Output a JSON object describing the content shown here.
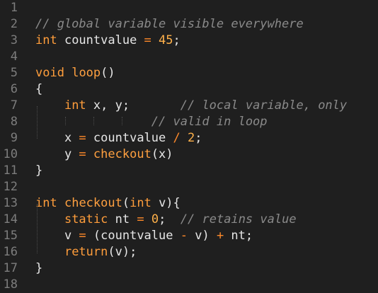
{
  "editor": {
    "background": "#1f1f1f",
    "colors": {
      "keyword": "#ff9d3b",
      "function": "#ffa040",
      "number": "#ffb14a",
      "operator": "#ff8a2a",
      "comment": "#8a8a8a",
      "text": "#e6e6e6",
      "line_number": "#7d7d7d"
    },
    "lines": [
      {
        "n": "1",
        "tokens": []
      },
      {
        "n": "2",
        "tokens": [
          {
            "t": "cm",
            "s": "// global variable visible everywhere"
          }
        ]
      },
      {
        "n": "3",
        "tokens": [
          {
            "t": "kw",
            "s": "int"
          },
          {
            "t": "tx",
            "s": " countvalue "
          },
          {
            "t": "op",
            "s": "="
          },
          {
            "t": "tx",
            "s": " "
          },
          {
            "t": "num",
            "s": "45"
          },
          {
            "t": "pn",
            "s": ";"
          }
        ]
      },
      {
        "n": "4",
        "tokens": []
      },
      {
        "n": "5",
        "tokens": [
          {
            "t": "kw",
            "s": "void"
          },
          {
            "t": "tx",
            "s": " "
          },
          {
            "t": "fn",
            "s": "loop"
          },
          {
            "t": "pn",
            "s": "()"
          }
        ]
      },
      {
        "n": "6",
        "tokens": [
          {
            "t": "pn",
            "s": "{"
          }
        ]
      },
      {
        "n": "7",
        "tokens": [
          {
            "t": "tx",
            "s": "    "
          },
          {
            "t": "kw",
            "s": "int"
          },
          {
            "t": "tx",
            "s": " x, y;       "
          },
          {
            "t": "cm",
            "s": "// local variable, only"
          }
        ]
      },
      {
        "n": "8",
        "tokens": [
          {
            "t": "tx",
            "s": "                "
          },
          {
            "t": "cm",
            "s": "// valid in loop"
          }
        ]
      },
      {
        "n": "9",
        "tokens": [
          {
            "t": "tx",
            "s": "    x "
          },
          {
            "t": "op",
            "s": "="
          },
          {
            "t": "tx",
            "s": " countvalue "
          },
          {
            "t": "op",
            "s": "/"
          },
          {
            "t": "tx",
            "s": " "
          },
          {
            "t": "num",
            "s": "2"
          },
          {
            "t": "pn",
            "s": ";"
          }
        ]
      },
      {
        "n": "10",
        "tokens": [
          {
            "t": "tx",
            "s": "    y "
          },
          {
            "t": "op",
            "s": "="
          },
          {
            "t": "tx",
            "s": " "
          },
          {
            "t": "fn",
            "s": "checkout"
          },
          {
            "t": "pn",
            "s": "(x)"
          }
        ]
      },
      {
        "n": "11",
        "tokens": [
          {
            "t": "pn",
            "s": "}"
          }
        ]
      },
      {
        "n": "12",
        "tokens": []
      },
      {
        "n": "13",
        "tokens": [
          {
            "t": "kw",
            "s": "int"
          },
          {
            "t": "tx",
            "s": " "
          },
          {
            "t": "fn",
            "s": "checkout"
          },
          {
            "t": "pn",
            "s": "("
          },
          {
            "t": "kw",
            "s": "int"
          },
          {
            "t": "tx",
            "s": " v){"
          }
        ]
      },
      {
        "n": "14",
        "tokens": [
          {
            "t": "tx",
            "s": "    "
          },
          {
            "t": "kw",
            "s": "static"
          },
          {
            "t": "tx",
            "s": " nt "
          },
          {
            "t": "op",
            "s": "="
          },
          {
            "t": "tx",
            "s": " "
          },
          {
            "t": "num",
            "s": "0"
          },
          {
            "t": "pn",
            "s": ";"
          },
          {
            "t": "tx",
            "s": "  "
          },
          {
            "t": "cm",
            "s": "// retains value"
          }
        ]
      },
      {
        "n": "15",
        "tokens": [
          {
            "t": "tx",
            "s": "    v "
          },
          {
            "t": "op",
            "s": "="
          },
          {
            "t": "tx",
            "s": " (countvalue "
          },
          {
            "t": "op",
            "s": "-"
          },
          {
            "t": "tx",
            "s": " v) "
          },
          {
            "t": "op",
            "s": "+"
          },
          {
            "t": "tx",
            "s": " nt;"
          }
        ]
      },
      {
        "n": "16",
        "tokens": [
          {
            "t": "tx",
            "s": "    "
          },
          {
            "t": "kw",
            "s": "return"
          },
          {
            "t": "pn",
            "s": "(v);"
          }
        ]
      },
      {
        "n": "17",
        "tokens": [
          {
            "t": "pn",
            "s": "}"
          }
        ]
      },
      {
        "n": "18",
        "tokens": []
      }
    ]
  }
}
